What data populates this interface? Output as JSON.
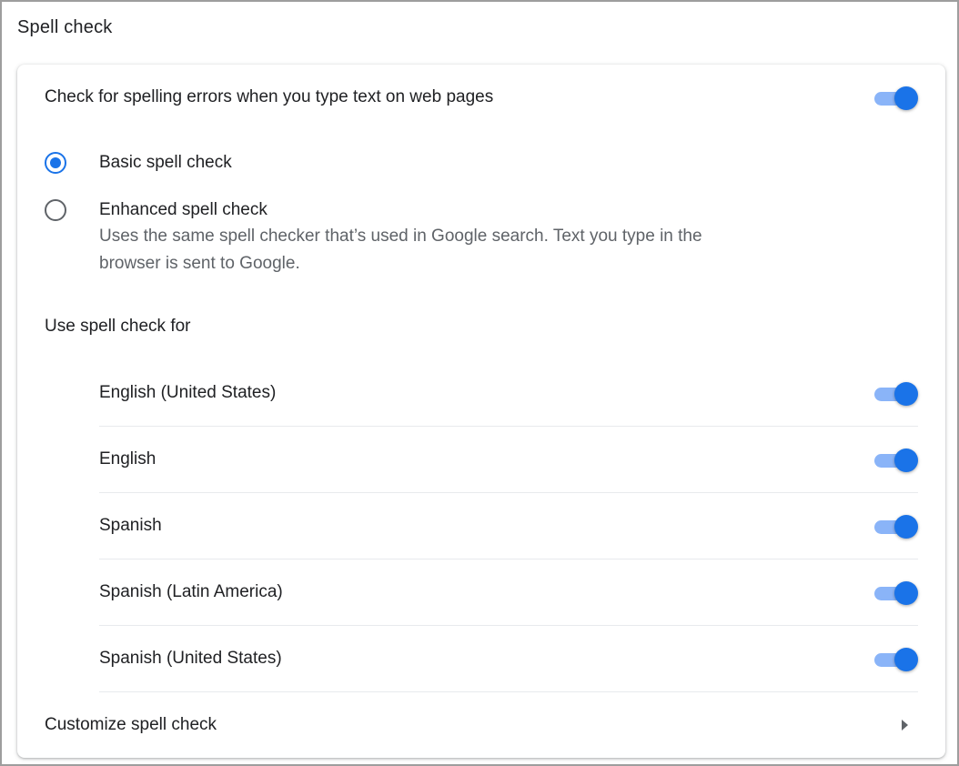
{
  "section": {
    "title": "Spell check"
  },
  "main_toggle": {
    "label": "Check for spelling errors when you type text on web pages",
    "enabled": true
  },
  "modes": [
    {
      "label": "Basic spell check",
      "selected": true,
      "description": ""
    },
    {
      "label": "Enhanced spell check",
      "selected": false,
      "description": "Uses the same spell checker that’s used in Google search. Text you type in the browser is sent to Google."
    }
  ],
  "languages": {
    "heading": "Use spell check for",
    "items": [
      {
        "label": "English (United States)",
        "enabled": true
      },
      {
        "label": "English",
        "enabled": true
      },
      {
        "label": "Spanish",
        "enabled": true
      },
      {
        "label": "Spanish (Latin America)",
        "enabled": true
      },
      {
        "label": "Spanish (United States)",
        "enabled": true
      }
    ]
  },
  "customize": {
    "label": "Customize spell check",
    "icon": "chevron-right-icon"
  },
  "colors": {
    "accent": "#1a73e8",
    "track": "#8ab4f8",
    "text_primary": "#202124",
    "text_secondary": "#5f6368"
  }
}
